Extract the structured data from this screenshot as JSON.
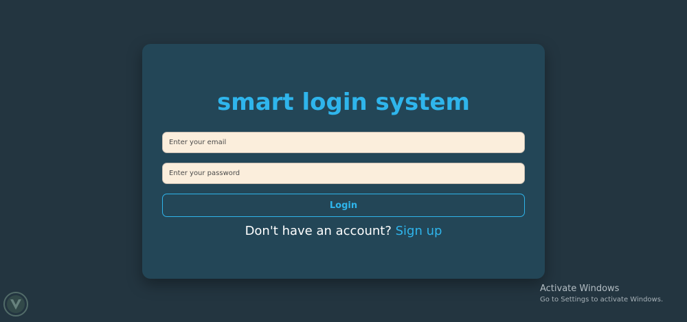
{
  "login_card": {
    "title": "smart login system",
    "email": {
      "placeholder": "Enter your email",
      "value": ""
    },
    "password": {
      "placeholder": "Enter your password",
      "value": ""
    },
    "login_label": "Login",
    "signup_prompt": "Don't have an account? ",
    "signup_link_label": "Sign up"
  },
  "windows_watermark": {
    "title": "Activate Windows",
    "subtitle": "Go to Settings to activate Windows."
  },
  "icons": {
    "corner_logo": "shield-logo-icon"
  },
  "colors": {
    "page_background": "#233540",
    "card_background": "#234657",
    "accent": "#2fb5ec",
    "input_background": "#fbeedc"
  }
}
